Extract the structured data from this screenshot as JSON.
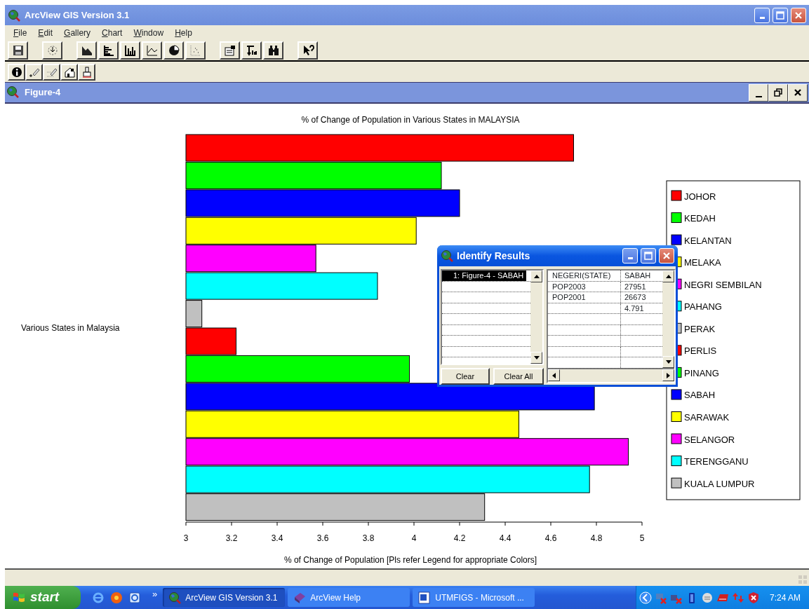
{
  "window": {
    "title": "ArcView GIS Version 3.1"
  },
  "menu": [
    {
      "label": "File"
    },
    {
      "label": "Edit"
    },
    {
      "label": "Gallery"
    },
    {
      "label": "Chart"
    },
    {
      "label": "Window"
    },
    {
      "label": "Help"
    }
  ],
  "figure_window": {
    "title": "Figure-4"
  },
  "chart": {
    "chart_data": {
      "type": "bar",
      "orientation": "horizontal",
      "title": "% of Change of Population in Various States in MALAYSIA",
      "xlabel": "% of Change of Population [Pls refer Legend for appropriate Colors]",
      "annotations": [
        {
          "text": "Various States in Malaysia"
        }
      ],
      "legend": "right",
      "series": [
        {
          "name": "JOHOR",
          "color": "#ff0000",
          "values": [
            4.7
          ]
        },
        {
          "name": "KEDAH",
          "color": "#00ff00",
          "values": [
            4.12
          ]
        },
        {
          "name": "KELANTAN",
          "color": "#0000ff",
          "values": [
            4.2
          ]
        },
        {
          "name": "MELAKA",
          "color": "#ffff00",
          "values": [
            4.01
          ]
        },
        {
          "name": "NEGRI SEMBILAN",
          "color": "#ff00ff",
          "values": [
            3.57
          ]
        },
        {
          "name": "PAHANG",
          "color": "#00ffff",
          "values": [
            3.84
          ]
        },
        {
          "name": "PERAK",
          "color": "#c0c0c0",
          "values": [
            3.07
          ]
        },
        {
          "name": "PERLIS",
          "color": "#ff0000",
          "values": [
            3.22
          ]
        },
        {
          "name": "PINANG",
          "color": "#00ff00",
          "values": [
            3.98
          ]
        },
        {
          "name": "SABAH",
          "color": "#0000ff",
          "values": [
            4.791
          ]
        },
        {
          "name": "SARAWAK",
          "color": "#ffff00",
          "values": [
            4.46
          ]
        },
        {
          "name": "SELANGOR",
          "color": "#ff00ff",
          "values": [
            4.94
          ]
        },
        {
          "name": "TERENGGANU",
          "color": "#00ffff",
          "values": [
            4.77
          ]
        },
        {
          "name": "KUALA LUMPUR",
          "color": "#c0c0c0",
          "values": [
            4.31
          ]
        }
      ],
      "xlim": [
        3,
        5
      ],
      "xticks": [
        {
          "value": 3,
          "label": "3"
        },
        {
          "value": 3.2,
          "label": "3.2"
        },
        {
          "value": 3.4,
          "label": "3.4"
        },
        {
          "value": 3.6,
          "label": "3.6"
        },
        {
          "value": 3.8,
          "label": "3.8"
        },
        {
          "value": 4,
          "label": "4"
        },
        {
          "value": 4.2,
          "label": "4.2"
        },
        {
          "value": 4.4,
          "label": "4.4"
        },
        {
          "value": 4.6,
          "label": "4.6"
        },
        {
          "value": 4.8,
          "label": "4.8"
        },
        {
          "value": 5,
          "label": "5"
        }
      ]
    }
  },
  "identify_results": {
    "title": "Identify Results",
    "results": [
      {
        "label": "1:  Figure-4 - SABAH",
        "selected": true
      }
    ],
    "attributes": [
      {
        "field": "NEGERI(STATE)",
        "value": "SABAH"
      },
      {
        "field": "POP2003",
        "value": "27951"
      },
      {
        "field": "POP2001",
        "value": "26673"
      },
      {
        "value": "4.791"
      }
    ],
    "buttons": [
      "Clear",
      "Clear All"
    ]
  },
  "taskbar": {
    "start": "start",
    "overflow": "»",
    "tasks": [
      {
        "label": "ArcView GIS Version 3.1",
        "selected": true
      },
      {
        "label": "ArcView Help",
        "selected": false
      },
      {
        "label": "UTMFIGS - Microsoft ...",
        "selected": false
      }
    ],
    "clock": "7:24 AM"
  }
}
